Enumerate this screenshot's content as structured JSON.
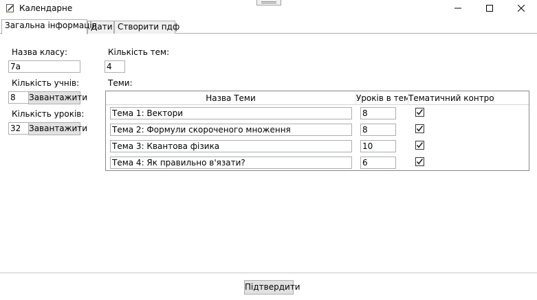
{
  "window": {
    "title": "Календарне",
    "app_icon": "notepad-pencil-icon",
    "controls": [
      "minimize-icon",
      "maximize-icon",
      "close-icon"
    ]
  },
  "tabs": [
    {
      "label": "Загальна інформація",
      "active": true
    },
    {
      "label": "Дати",
      "active": false
    },
    {
      "label": "Створити пдф",
      "active": false
    }
  ],
  "form": {
    "class_name_label": "Назва класу:",
    "class_name_value": "7а",
    "students_label": "Кількість учнів:",
    "students_value": "8",
    "students_load": "Завантажити",
    "lessons_label": "Кількість уроків:",
    "lessons_value": "32",
    "lessons_load": "Завантажити",
    "topics_count_label": "Кількість тем:",
    "topics_count_value": "4",
    "topics_label": "Теми:"
  },
  "grid": {
    "columns": [
      "Назва Теми",
      "Уроків в темі",
      "Тематичний контроль"
    ],
    "rows": [
      {
        "name": "Тема 1: Вектори",
        "lessons": "8",
        "control": true
      },
      {
        "name": "Тема 2: Формули скороченого множення",
        "lessons": "8",
        "control": true
      },
      {
        "name": "Тема 3: Квантова фізика",
        "lessons": "10",
        "control": true
      },
      {
        "name": "Тема 4: Як правильно в'язати?",
        "lessons": "6",
        "control": true
      }
    ]
  },
  "footer": {
    "confirm_label": "Підтвердити"
  }
}
